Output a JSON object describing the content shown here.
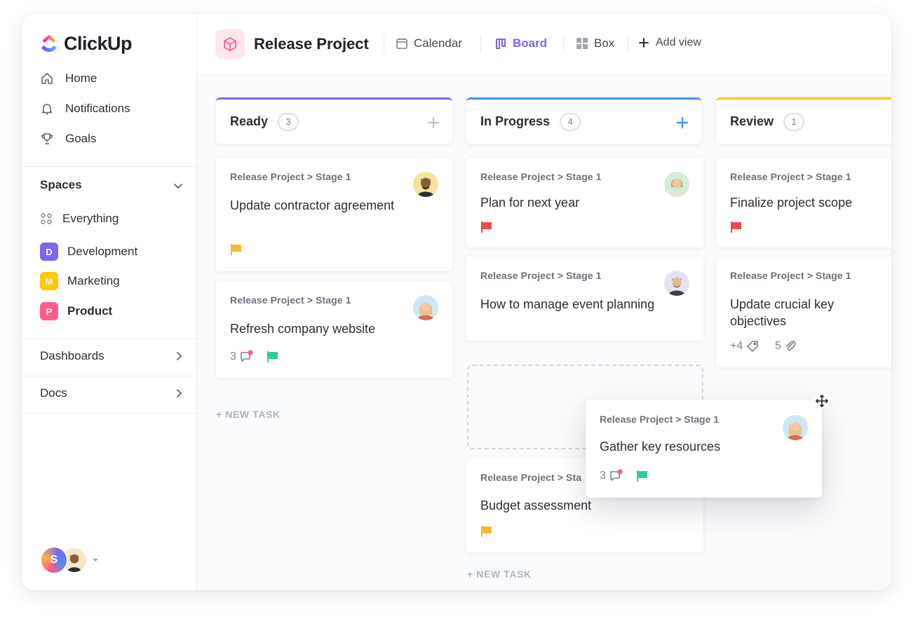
{
  "app": {
    "name": "ClickUp"
  },
  "sidebar": {
    "nav": [
      {
        "label": "Home",
        "icon": "home-icon"
      },
      {
        "label": "Notifications",
        "icon": "bell-icon"
      },
      {
        "label": "Goals",
        "icon": "trophy-icon"
      }
    ],
    "spaces_title": "Spaces",
    "spaces": [
      {
        "label": "Everything",
        "icon": "grid-dots-icon"
      },
      {
        "label": "Development",
        "badge": "D",
        "color": "#7b68ee"
      },
      {
        "label": "Marketing",
        "badge": "M",
        "color": "#ffc800"
      },
      {
        "label": "Product",
        "badge": "P",
        "color": "#ff5b8b",
        "active": true
      }
    ],
    "sections": [
      {
        "label": "Dashboards"
      },
      {
        "label": "Docs"
      }
    ],
    "user_initial": "S"
  },
  "header": {
    "project_title": "Release Project",
    "views": [
      {
        "label": "Calendar",
        "icon": "calendar-icon"
      },
      {
        "label": "Board",
        "icon": "board-icon",
        "active": true
      },
      {
        "label": "Box",
        "icon": "box-grid-icon"
      },
      {
        "label": "Add view",
        "icon": "plus-icon"
      }
    ]
  },
  "board": {
    "new_task_label": "+ NEW TASK",
    "columns": [
      {
        "title": "Ready",
        "count": "3",
        "color": "#7b68ee",
        "cards": [
          {
            "crumb": "Release Project > Stage 1",
            "title": "Update contractor agreement",
            "flag": "#f7b731"
          },
          {
            "crumb": "Release Project > Stage 1",
            "title": "Refresh company website",
            "comments": "3",
            "flag": "#2ecd9a"
          }
        ]
      },
      {
        "title": "In Progress",
        "count": "4",
        "color": "#4194f6",
        "cards": [
          {
            "crumb": "Release Project > Stage 1",
            "title": "Plan for next year",
            "flag": "#f0484e"
          },
          {
            "crumb": "Release Project > Stage 1",
            "title": "How to manage event planning"
          },
          {
            "crumb": "Release Project > Sta",
            "title": "Budget assessment",
            "flag": "#f7b731"
          }
        ]
      },
      {
        "title": "Review",
        "count": "1",
        "color": "#ffc800",
        "cards": [
          {
            "crumb": "Release Project > Stage 1",
            "title": "Finalize project scope",
            "flag": "#f0484e"
          },
          {
            "crumb": "Release Project > Stage 1",
            "title": "Update crucial key objectives",
            "tags": "+4",
            "attachments": "5"
          }
        ]
      }
    ],
    "dragging_card": {
      "crumb": "Release Project > Stage 1",
      "title": "Gather key resources",
      "comments": "3",
      "flag": "#2ecd9a"
    }
  }
}
